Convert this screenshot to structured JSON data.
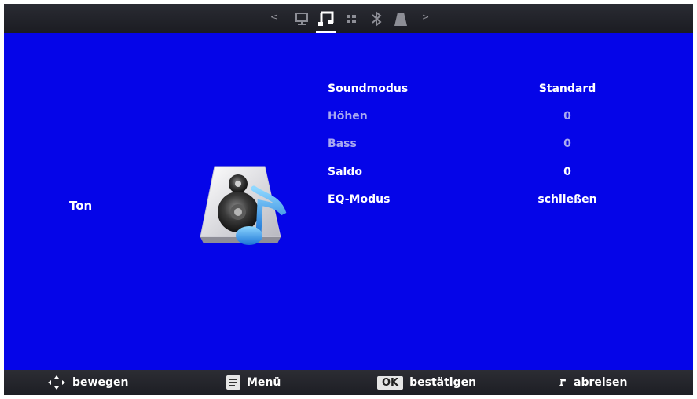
{
  "tabs": [
    {
      "name": "monitor-icon",
      "active": false
    },
    {
      "name": "music-note-icon",
      "active": true
    },
    {
      "name": "grid-icon",
      "active": false
    },
    {
      "name": "bluetooth-icon",
      "active": false
    },
    {
      "name": "lock-icon",
      "active": false
    }
  ],
  "tab_arrows": {
    "left": "<",
    "right": ">"
  },
  "section": {
    "label": "Ton",
    "icon": "speaker-music-icon"
  },
  "settings": [
    {
      "label": "Soundmodus",
      "value": "Standard",
      "enabled": true
    },
    {
      "label": "Höhen",
      "value": "0",
      "enabled": false
    },
    {
      "label": "Bass",
      "value": "0",
      "enabled": false
    },
    {
      "label": "Saldo",
      "value": "0",
      "enabled": true
    },
    {
      "label": "EQ-Modus",
      "value": "schließen",
      "enabled": true
    }
  ],
  "hints": {
    "move": "bewegen",
    "menu": "Menü",
    "ok_key": "OK",
    "confirm": "bestätigen",
    "back": "abreisen"
  },
  "colors": {
    "background": "#0505e8",
    "bar": "#22232a",
    "text": "#ffffff",
    "disabled_text": "#a9a9f0"
  }
}
